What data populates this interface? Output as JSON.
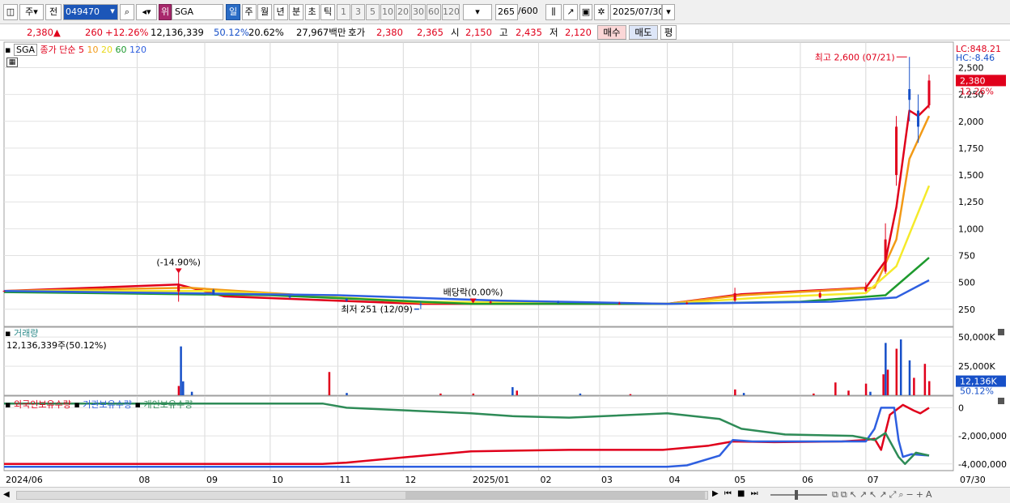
{
  "toolbar": {
    "market": "주",
    "prev": "전",
    "code": "049470",
    "grade": "위",
    "name": "SGA",
    "periods": [
      "일",
      "주",
      "월",
      "년",
      "분",
      "초",
      "틱"
    ],
    "active_period": "일",
    "intervals": [
      "1",
      "3",
      "5",
      "10",
      "20",
      "30",
      "60",
      "120"
    ],
    "count": "265",
    "count_max": "/600",
    "date": "2025/07/30"
  },
  "price_bar": {
    "price": "2,380",
    "price_arrow": "▲",
    "change": "260",
    "change_pct": "+12.26%",
    "volume": "12,136,339",
    "vol_ratio": "50.12%",
    "turnover": "20.62%",
    "amount": "27,967백만",
    "quote_label": "호가",
    "ask": "2,380",
    "bid": "2,365",
    "open_label": "시",
    "open": "2,150",
    "high_label": "고",
    "high": "2,435",
    "low_label": "저",
    "low": "2,120",
    "buy_label": "매수",
    "sell_label": "매도",
    "avg_label": "평"
  },
  "colors": {
    "up": "#e0001b",
    "down": "#1750c8",
    "ma5": "#e0001b",
    "ma10": "#f29a16",
    "ma20": "#f5ea2a",
    "ma60": "#1e9a2e",
    "ma120": "#2e5fe0",
    "foreign": "#e0001b",
    "institution": "#2e5fe0",
    "individual": "#2e8b57"
  },
  "chart_data": [
    {
      "type": "candlestick",
      "legend": {
        "symbol": "SGA",
        "price_label": "종가 단순",
        "ma_periods": [
          "5",
          "10",
          "20",
          "60",
          "120"
        ]
      },
      "y_ticks": [
        250,
        500,
        750,
        1000,
        1250,
        1500,
        1750,
        2000,
        2250,
        2500
      ],
      "y_tick_labels": [
        "250",
        "500",
        "750",
        "1,000",
        "1,250",
        "1,500",
        "1,750",
        "2,000",
        "2,250",
        "2,500"
      ],
      "ylim": [
        120,
        2700
      ],
      "x_axis": {
        "range": [
          "2024-06-01",
          "2025-07-30"
        ],
        "labels": [
          {
            "label": "2024/06",
            "date": "2024-06-01"
          },
          {
            "label": "08",
            "date": "2024-08-01"
          },
          {
            "label": "09",
            "date": "2024-09-01"
          },
          {
            "label": "10",
            "date": "2024-10-01"
          },
          {
            "label": "11",
            "date": "2024-11-01"
          },
          {
            "label": "12",
            "date": "2024-12-01"
          },
          {
            "label": "2025/01",
            "date": "2025-01-01"
          },
          {
            "label": "02",
            "date": "2025-02-01"
          },
          {
            "label": "03",
            "date": "2025-03-01"
          },
          {
            "label": "04",
            "date": "2025-04-01"
          },
          {
            "label": "05",
            "date": "2025-05-01"
          },
          {
            "label": "06",
            "date": "2025-06-01"
          },
          {
            "label": "07",
            "date": "2025-07-01"
          },
          {
            "label": "07/30",
            "date": "2025-07-30"
          }
        ]
      },
      "candles_ohlc_by_date": [
        [
          "2024-06-01",
          420,
          425,
          415,
          420
        ],
        [
          "2024-08-20",
          415,
          600,
          320,
          470
        ],
        [
          "2024-09-05",
          430,
          440,
          380,
          385
        ],
        [
          "2024-10-10",
          370,
          380,
          350,
          360
        ],
        [
          "2024-11-05",
          345,
          355,
          320,
          330
        ],
        [
          "2024-12-09",
          300,
          320,
          251,
          290
        ],
        [
          "2025-01-10",
          310,
          330,
          300,
          320
        ],
        [
          "2025-02-10",
          315,
          330,
          300,
          310
        ],
        [
          "2025-03-10",
          300,
          320,
          290,
          305
        ],
        [
          "2025-04-10",
          305,
          320,
          295,
          310
        ],
        [
          "2025-05-02",
          330,
          450,
          320,
          400
        ],
        [
          "2025-06-10",
          360,
          420,
          350,
          400
        ],
        [
          "2025-07-01",
          420,
          500,
          410,
          460
        ],
        [
          "2025-07-10",
          600,
          1050,
          580,
          900
        ],
        [
          "2025-07-15",
          1500,
          2050,
          1400,
          1950
        ],
        [
          "2025-07-21",
          2300,
          2600,
          2000,
          2200
        ],
        [
          "2025-07-25",
          2100,
          2250,
          1800,
          1950
        ],
        [
          "2025-07-30",
          2150,
          2435,
          2120,
          2380
        ]
      ],
      "moving_averages": [
        {
          "name": "5",
          "points": [
            [
              "2024-06-01",
              420
            ],
            [
              "2024-08-20",
              480
            ],
            [
              "2024-09-10",
              370
            ],
            [
              "2024-12-09",
              300
            ],
            [
              "2025-04-01",
              300
            ],
            [
              "2025-05-05",
              390
            ],
            [
              "2025-07-01",
              450
            ],
            [
              "2025-07-10",
              700
            ],
            [
              "2025-07-15",
              1200
            ],
            [
              "2025-07-21",
              2100
            ],
            [
              "2025-07-25",
              2050
            ],
            [
              "2025-07-30",
              2150
            ]
          ]
        },
        {
          "name": "10",
          "points": [
            [
              "2024-06-01",
              420
            ],
            [
              "2024-08-25",
              450
            ],
            [
              "2024-12-09",
              310
            ],
            [
              "2025-04-01",
              300
            ],
            [
              "2025-05-05",
              380
            ],
            [
              "2025-07-05",
              450
            ],
            [
              "2025-07-15",
              900
            ],
            [
              "2025-07-21",
              1650
            ],
            [
              "2025-07-30",
              2050
            ]
          ]
        },
        {
          "name": "20",
          "points": [
            [
              "2024-06-01",
              420
            ],
            [
              "2024-09-05",
              420
            ],
            [
              "2024-12-09",
              320
            ],
            [
              "2025-04-01",
              300
            ],
            [
              "2025-05-15",
              360
            ],
            [
              "2025-07-01",
              400
            ],
            [
              "2025-07-15",
              650
            ],
            [
              "2025-07-30",
              1400
            ]
          ]
        },
        {
          "name": "60",
          "points": [
            [
              "2024-06-01",
              410
            ],
            [
              "2024-10-01",
              380
            ],
            [
              "2025-01-01",
              300
            ],
            [
              "2025-04-01",
              300
            ],
            [
              "2025-06-01",
              320
            ],
            [
              "2025-07-10",
              380
            ],
            [
              "2025-07-30",
              730
            ]
          ]
        },
        {
          "name": "120",
          "points": [
            [
              "2024-06-01",
              420
            ],
            [
              "2024-11-01",
              380
            ],
            [
              "2025-01-15",
              330
            ],
            [
              "2025-04-01",
              300
            ],
            [
              "2025-06-15",
              320
            ],
            [
              "2025-07-15",
              360
            ],
            [
              "2025-07-30",
              520
            ]
          ]
        }
      ],
      "annotations": [
        {
          "text": "최고 2,600 (07/21)",
          "date": "2025-07-21",
          "value": 2600,
          "kind": "high"
        },
        {
          "text": "최저 251 (12/09)",
          "date": "2024-12-09",
          "value": 251,
          "kind": "low"
        },
        {
          "text": "(-14.90%)",
          "date": "2024-08-20",
          "value": 600,
          "kind": "event"
        },
        {
          "text": "배당락(0.00%)",
          "date": "2025-01-02",
          "value": 320,
          "kind": "event"
        }
      ],
      "right_labels": {
        "lc": "LC:848.21",
        "hc": "HC:-8.46",
        "price_tag": "2,380",
        "pct_tag": "12.26%"
      }
    },
    {
      "type": "bar",
      "legend": {
        "name": "거래량",
        "value_text": "12,136,339주(50.12%)"
      },
      "y_ticks": [
        25000,
        50000
      ],
      "y_tick_labels": [
        "25,000K",
        "50,000K"
      ],
      "ylim": [
        0,
        55000
      ],
      "unit": "K",
      "volume_bars_by_date": [
        [
          "2024-08-20",
          8000,
          "up"
        ],
        [
          "2024-08-21",
          42000,
          "down"
        ],
        [
          "2024-08-22",
          12000,
          "down"
        ],
        [
          "2024-08-26",
          3000,
          "down"
        ],
        [
          "2024-10-28",
          20000,
          "up"
        ],
        [
          "2024-11-05",
          2000,
          "down"
        ],
        [
          "2024-12-18",
          1500,
          "up"
        ],
        [
          "2025-01-02",
          1500,
          "up"
        ],
        [
          "2025-01-20",
          7000,
          "down"
        ],
        [
          "2025-01-22",
          4000,
          "up"
        ],
        [
          "2025-02-20",
          1500,
          "down"
        ],
        [
          "2025-03-15",
          1000,
          "up"
        ],
        [
          "2025-05-02",
          5000,
          "up"
        ],
        [
          "2025-05-06",
          2000,
          "down"
        ],
        [
          "2025-06-07",
          1500,
          "up"
        ],
        [
          "2025-06-17",
          11000,
          "up"
        ],
        [
          "2025-06-23",
          4000,
          "up"
        ],
        [
          "2025-07-01",
          10000,
          "up"
        ],
        [
          "2025-07-03",
          3000,
          "down"
        ],
        [
          "2025-07-09",
          18000,
          "up"
        ],
        [
          "2025-07-10",
          45000,
          "down"
        ],
        [
          "2025-07-11",
          22000,
          "up"
        ],
        [
          "2025-07-15",
          40000,
          "up"
        ],
        [
          "2025-07-17",
          48000,
          "down"
        ],
        [
          "2025-07-21",
          30000,
          "down"
        ],
        [
          "2025-07-23",
          15000,
          "up"
        ],
        [
          "2025-07-28",
          27000,
          "up"
        ],
        [
          "2025-07-30",
          12136,
          "up"
        ]
      ],
      "right_labels": {
        "value_tag": "12,136K",
        "pct_tag": "50.12%"
      }
    },
    {
      "type": "line",
      "series": [
        {
          "name": "외국인보유수량",
          "points": [
            [
              "2024-06-01",
              -4000000
            ],
            [
              "2024-08-20",
              -4000000
            ],
            [
              "2024-10-25",
              -4000000
            ],
            [
              "2024-11-05",
              -3900000
            ],
            [
              "2025-01-01",
              -3100000
            ],
            [
              "2025-02-15",
              -3000000
            ],
            [
              "2025-03-30",
              -3000000
            ],
            [
              "2025-04-20",
              -2700000
            ],
            [
              "2025-05-01",
              -2400000
            ],
            [
              "2025-05-20",
              -2450000
            ],
            [
              "2025-06-20",
              -2400000
            ],
            [
              "2025-07-01",
              -2300000
            ],
            [
              "2025-07-05",
              -2200000
            ],
            [
              "2025-07-08",
              -3000000
            ],
            [
              "2025-07-12",
              -500000
            ],
            [
              "2025-07-18",
              200000
            ],
            [
              "2025-07-23",
              -200000
            ],
            [
              "2025-07-26",
              -400000
            ],
            [
              "2025-07-30",
              0
            ]
          ]
        },
        {
          "name": "기관보유수량",
          "points": [
            [
              "2024-06-01",
              -4200000
            ],
            [
              "2024-12-01",
              -4200000
            ],
            [
              "2025-01-01",
              -4200000
            ],
            [
              "2025-04-01",
              -4200000
            ],
            [
              "2025-04-10",
              -4100000
            ],
            [
              "2025-04-25",
              -3400000
            ],
            [
              "2025-05-01",
              -2300000
            ],
            [
              "2025-05-10",
              -2400000
            ],
            [
              "2025-07-01",
              -2400000
            ],
            [
              "2025-07-05",
              -1500000
            ],
            [
              "2025-07-08",
              0
            ],
            [
              "2025-07-14",
              0
            ],
            [
              "2025-07-16",
              -2300000
            ],
            [
              "2025-07-18",
              -3500000
            ],
            [
              "2025-07-22",
              -3300000
            ],
            [
              "2025-07-30",
              -3400000
            ]
          ]
        },
        {
          "name": "개인보유수량",
          "points": [
            [
              "2024-06-01",
              300000
            ],
            [
              "2024-10-25",
              300000
            ],
            [
              "2024-11-05",
              0
            ],
            [
              "2025-01-01",
              -400000
            ],
            [
              "2025-01-20",
              -600000
            ],
            [
              "2025-02-15",
              -700000
            ],
            [
              "2025-04-01",
              -400000
            ],
            [
              "2025-04-25",
              -800000
            ],
            [
              "2025-05-05",
              -1500000
            ],
            [
              "2025-05-25",
              -1900000
            ],
            [
              "2025-06-25",
              -2000000
            ],
            [
              "2025-07-05",
              -2300000
            ],
            [
              "2025-07-10",
              -1800000
            ],
            [
              "2025-07-16",
              -3500000
            ],
            [
              "2025-07-19",
              -4000000
            ],
            [
              "2025-07-24",
              -3200000
            ],
            [
              "2025-07-30",
              -3400000
            ]
          ]
        }
      ],
      "y_ticks": [
        0,
        -2000000,
        -4000000
      ],
      "y_tick_labels": [
        "0",
        "-2,000,000",
        "-4,000,000"
      ],
      "ylim": [
        -4300000,
        600000
      ]
    }
  ]
}
